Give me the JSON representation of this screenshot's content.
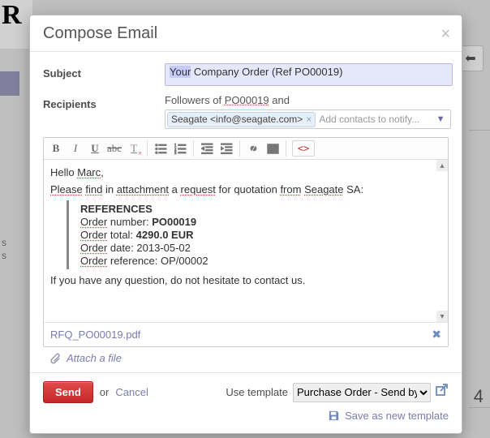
{
  "header": {
    "title": "Compose Email"
  },
  "form": {
    "subject_label": "Subject",
    "subject_value_highlight": "Your",
    "subject_value_rest": " Company Order (Ref PO00019)",
    "recipients_label": "Recipients",
    "followers_prefix": "Followers of",
    "followers_ref": "PO00019",
    "followers_suffix": " and",
    "recipient_tag": "Seagate <info@seagate.com>",
    "recipients_placeholder": "Add contacts to notify..."
  },
  "body": {
    "greeting_pre": "Hello",
    "greeting_name": "Marc",
    "w1": "Please",
    "w2": "find",
    "w3": "in",
    "w4": "attachment",
    "w5": "a",
    "w6": "request",
    "w7": "for quotation",
    "w8": "from",
    "w9": "Seagate",
    "w10": "SA:",
    "ref_heading": "REFERENCES",
    "ref1a": "Order",
    "ref1b": "number:",
    "ref1c": "PO00019",
    "ref2a": "Order",
    "ref2b": "total:",
    "ref2c": "4290.0 EUR",
    "ref3a": "Order",
    "ref3b": "date: 2013-05-02",
    "ref4a": "Order",
    "ref4b": "reference: OP/00002",
    "closing": "If you have any question, do not hesitate to contact us."
  },
  "attachments": [
    {
      "name": "RFQ_PO00019.pdf"
    }
  ],
  "attach_label": "Attach a file",
  "footer": {
    "send": "Send",
    "or": "or",
    "cancel": "Cancel",
    "use_template": "Use template",
    "template_value": "Purchase Order - Send by Email",
    "save_template": "Save as new template"
  }
}
